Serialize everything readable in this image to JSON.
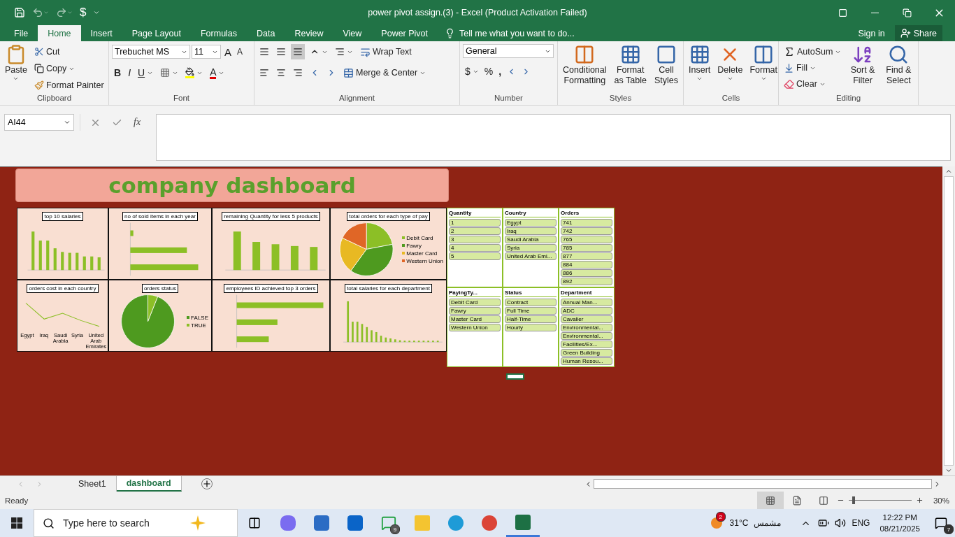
{
  "window": {
    "title": "power pivot assign.(3) - Excel (Product Activation Failed)",
    "quick_access_currency": "$"
  },
  "menu_tabs": [
    {
      "label": "File",
      "selected": false
    },
    {
      "label": "Home",
      "selected": true
    },
    {
      "label": "Insert",
      "selected": false
    },
    {
      "label": "Page Layout",
      "selected": false
    },
    {
      "label": "Formulas",
      "selected": false
    },
    {
      "label": "Data",
      "selected": false
    },
    {
      "label": "Review",
      "selected": false
    },
    {
      "label": "View",
      "selected": false
    },
    {
      "label": "Power Pivot",
      "selected": false
    }
  ],
  "tell_me": {
    "placeholder": "Tell me what you want to do..."
  },
  "account": {
    "sign_in": "Sign in",
    "share": "Share"
  },
  "ribbon": {
    "paste": "Paste",
    "cut": "Cut",
    "copy": "Copy",
    "format_painter": "Format Painter",
    "font_name": "Trebuchet MS",
    "font_size": "11",
    "grow_font": "A",
    "shrink_font": "A",
    "bold": "B",
    "italic": "I",
    "underline": "U",
    "font_color": "A",
    "wrap_text": "Wrap Text",
    "merge_center": "Merge & Center",
    "number_format": "General",
    "currency": "$",
    "percent": "%",
    "comma": ",",
    "conditional_formatting": "Conditional Formatting",
    "format_as_table": "Format as Table",
    "cell_styles": "Cell Styles",
    "insert": "Insert",
    "delete": "Delete",
    "format": "Format",
    "autosum": "AutoSum",
    "fill": "Fill",
    "clear": "Clear",
    "sort_filter": "Sort & Filter",
    "find_select": "Find & Select",
    "group_labels": [
      "Clipboard",
      "Font",
      "Alignment",
      "Number",
      "Styles",
      "Cells",
      "Editing"
    ]
  },
  "formula_bar": {
    "name_box": "AI44",
    "function_label": "fx"
  },
  "dashboard": {
    "title": "company dashboard",
    "charts": [
      {
        "title": "top 10 salaries",
        "kind": "column"
      },
      {
        "title": "no of sold items in each year",
        "kind": "bar"
      },
      {
        "title": "remaining Quantity for less 5 products",
        "kind": "column"
      },
      {
        "title": "total orders for each type of pay",
        "kind": "pie",
        "legend": [
          {
            "label": "Debit Card",
            "color": "#8cbf26"
          },
          {
            "label": "Fawry",
            "color": "#4e9a1f"
          },
          {
            "label": "Master Card",
            "color": "#e8b923"
          },
          {
            "label": "Western Union",
            "color": "#e06626"
          }
        ]
      },
      {
        "title": "orders cost in each country",
        "kind": "line",
        "categories": [
          "Egypt",
          "Iraq",
          "Saudi Arabia",
          "Syria",
          "United Arab Emirates"
        ]
      },
      {
        "title": "orders status",
        "kind": "pie",
        "legend": [
          {
            "label": "FALSE",
            "color": "#4e9a1f"
          },
          {
            "label": "TRUE",
            "color": "#8cbf26"
          }
        ]
      },
      {
        "title": "employees ID achieved top 3 orders",
        "kind": "bar"
      },
      {
        "title": "total salaries for each department",
        "kind": "column"
      }
    ],
    "slicers": [
      {
        "header": "Quantity",
        "items": [
          {
            "label": "1",
            "selected": true
          },
          {
            "label": "2",
            "selected": true
          },
          {
            "label": "3",
            "selected": true
          },
          {
            "label": "4",
            "selected": true
          },
          {
            "label": "5",
            "selected": true
          }
        ]
      },
      {
        "header": "Country",
        "items": [
          {
            "label": "Egypt",
            "selected": true
          },
          {
            "label": "Iraq",
            "selected": true
          },
          {
            "label": "Saudi Arabia",
            "selected": true
          },
          {
            "label": "Syria",
            "selected": true
          },
          {
            "label": "United Arab Emi...",
            "selected": true
          }
        ]
      },
      {
        "header": "Orders",
        "items": [
          {
            "label": "741",
            "selected": true
          },
          {
            "label": "742",
            "selected": true
          },
          {
            "label": "765",
            "selected": true
          },
          {
            "label": "785",
            "selected": true
          },
          {
            "label": "877",
            "selected": true
          },
          {
            "label": "884",
            "selected": true
          },
          {
            "label": "886",
            "selected": true
          },
          {
            "label": "892",
            "selected": true
          }
        ]
      },
      {
        "header": "PayingTy...",
        "items": [
          {
            "label": "Debit Card",
            "selected": true
          },
          {
            "label": "Fawry",
            "selected": true
          },
          {
            "label": "Master Card",
            "selected": true
          },
          {
            "label": "Western Union",
            "selected": true
          }
        ]
      },
      {
        "header": "Status",
        "items": [
          {
            "label": "Contract",
            "selected": true
          },
          {
            "label": "Full Time",
            "selected": true
          },
          {
            "label": "Half-Time",
            "selected": true
          },
          {
            "label": "Hourly",
            "selected": true
          }
        ]
      },
      {
        "header": "Department",
        "items": [
          {
            "label": "Annual Man...",
            "selected": true
          },
          {
            "label": "ADC",
            "selected": true
          },
          {
            "label": "Cavalier",
            "selected": true
          },
          {
            "label": "Environmental...",
            "selected": true
          },
          {
            "label": "Environmental...",
            "selected": true
          },
          {
            "label": "Facilities/Ex...",
            "selected": true
          },
          {
            "label": "Green Building",
            "selected": true
          },
          {
            "label": "Human Resou...",
            "selected": true
          }
        ]
      }
    ]
  },
  "sheet_tabs": [
    {
      "label": "Sheet1",
      "selected": false
    },
    {
      "label": "dashboard",
      "selected": true
    }
  ],
  "status_bar": {
    "status": "Ready",
    "zoom": {
      "level": 0.06,
      "reading": "30%"
    }
  },
  "taskbar": {
    "search": {
      "placeholder": "Type here to search"
    },
    "whatsapp_badge": "9",
    "weather_badge": "2",
    "temperature": "31°C",
    "weather": "مشمس",
    "language": "ENG",
    "time": "12:22 PM",
    "date": "08/21/2025",
    "notifications": "7"
  }
}
